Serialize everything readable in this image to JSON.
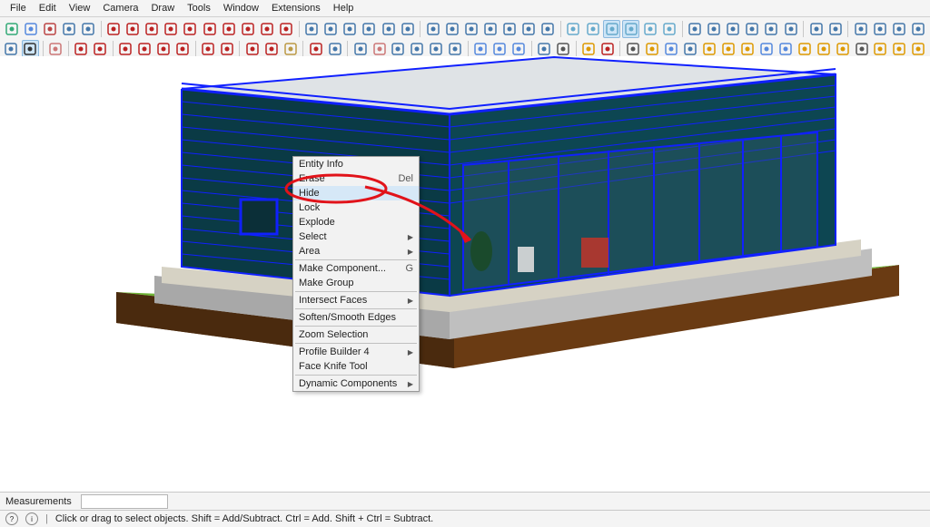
{
  "menu": [
    "File",
    "Edit",
    "View",
    "Camera",
    "Draw",
    "Tools",
    "Window",
    "Extensions",
    "Help"
  ],
  "toolbar_row1": [
    {
      "n": "today-icon",
      "c": "#3a7"
    },
    {
      "n": "component-icon",
      "c": "#58d"
    },
    {
      "n": "realtime-icon",
      "c": "#b44"
    },
    {
      "n": "undo-icon",
      "c": "#47a"
    },
    {
      "n": "redo-icon",
      "c": "#47a"
    },
    {
      "s": true
    },
    {
      "n": "line-icon",
      "c": "#b22"
    },
    {
      "n": "freehand-icon",
      "c": "#b22"
    },
    {
      "n": "rectangle-icon",
      "c": "#b22"
    },
    {
      "n": "rotrect-icon",
      "c": "#b22"
    },
    {
      "n": "circle-icon",
      "c": "#b22"
    },
    {
      "n": "polygon-icon",
      "c": "#b22"
    },
    {
      "n": "arc-icon",
      "c": "#b22"
    },
    {
      "n": "arc2-icon",
      "c": "#b22"
    },
    {
      "n": "arc3-icon",
      "c": "#b22"
    },
    {
      "n": "pie-icon",
      "c": "#b22"
    },
    {
      "s": true
    },
    {
      "n": "tape-icon",
      "c": "#47a"
    },
    {
      "n": "dimension-icon",
      "c": "#47a"
    },
    {
      "n": "protractor-icon",
      "c": "#47a"
    },
    {
      "n": "text-icon",
      "c": "#47a"
    },
    {
      "n": "axes-icon",
      "c": "#47a"
    },
    {
      "n": "3dtext-icon",
      "c": "#47a"
    },
    {
      "s": true
    },
    {
      "n": "iso-icon",
      "c": "#47a"
    },
    {
      "n": "top-icon",
      "c": "#47a"
    },
    {
      "n": "front-icon",
      "c": "#47a"
    },
    {
      "n": "right-icon",
      "c": "#47a"
    },
    {
      "n": "back-icon",
      "c": "#47a"
    },
    {
      "n": "left-icon",
      "c": "#47a"
    },
    {
      "n": "bottom-icon",
      "c": "#47a"
    },
    {
      "s": true
    },
    {
      "n": "xray-icon",
      "c": "#6ac"
    },
    {
      "n": "wireframe-icon",
      "c": "#6ac"
    },
    {
      "n": "hidden-icon",
      "c": "#6ac",
      "a": true
    },
    {
      "n": "shaded-icon",
      "c": "#6ac",
      "a": true
    },
    {
      "n": "shadedtex-icon",
      "c": "#6ac"
    },
    {
      "n": "mono-icon",
      "c": "#6ac"
    },
    {
      "s": true
    },
    {
      "n": "solid1-icon",
      "c": "#47a"
    },
    {
      "n": "solid2-icon",
      "c": "#47a"
    },
    {
      "n": "solid3-icon",
      "c": "#47a"
    },
    {
      "n": "solid4-icon",
      "c": "#47a"
    },
    {
      "n": "solid5-icon",
      "c": "#47a"
    },
    {
      "n": "solid6-icon",
      "c": "#47a"
    },
    {
      "s": true
    },
    {
      "n": "solid7-icon",
      "c": "#47a"
    },
    {
      "n": "solid8-icon",
      "c": "#47a"
    },
    {
      "s": true
    },
    {
      "n": "gear1-icon",
      "c": "#47a"
    },
    {
      "n": "gear2-icon",
      "c": "#47a"
    },
    {
      "n": "gear3-icon",
      "c": "#47a"
    },
    {
      "n": "gear4-icon",
      "c": "#47a"
    }
  ],
  "toolbar_row2": [
    {
      "n": "zoom-icon",
      "c": "#47a"
    },
    {
      "n": "select-icon",
      "c": "#333",
      "a": true
    },
    {
      "s": true
    },
    {
      "n": "eraser-icon",
      "c": "#c77"
    },
    {
      "s": true
    },
    {
      "n": "line2-icon",
      "c": "#b22"
    },
    {
      "n": "freehand2-icon",
      "c": "#b22"
    },
    {
      "s": true
    },
    {
      "n": "rect2-icon",
      "c": "#b22"
    },
    {
      "n": "rotrect2-icon",
      "c": "#b22"
    },
    {
      "n": "circle2-icon",
      "c": "#b22"
    },
    {
      "n": "arc2b-icon",
      "c": "#b22"
    },
    {
      "s": true
    },
    {
      "n": "pushpull-icon",
      "c": "#b22"
    },
    {
      "n": "offset-icon",
      "c": "#b22"
    },
    {
      "s": true
    },
    {
      "n": "move-icon",
      "c": "#b22"
    },
    {
      "n": "rotate-icon",
      "c": "#b22"
    },
    {
      "n": "scale-icon",
      "c": "#b94"
    },
    {
      "s": true
    },
    {
      "n": "followme-icon",
      "c": "#b22"
    },
    {
      "n": "section-icon",
      "c": "#47a"
    },
    {
      "s": true
    },
    {
      "n": "orbit-icon",
      "c": "#47a"
    },
    {
      "n": "pan-icon",
      "c": "#c77"
    },
    {
      "n": "zoom2-icon",
      "c": "#47a"
    },
    {
      "n": "zoomwin-icon",
      "c": "#47a"
    },
    {
      "n": "zoomext-icon",
      "c": "#47a"
    },
    {
      "n": "prev-icon",
      "c": "#47a"
    },
    {
      "s": true
    },
    {
      "n": "layers1-icon",
      "c": "#58d"
    },
    {
      "n": "layers2-icon",
      "c": "#58d"
    },
    {
      "n": "layers3-icon",
      "c": "#58d"
    },
    {
      "s": true
    },
    {
      "n": "newdoc-icon",
      "c": "#47a"
    },
    {
      "n": "person-icon",
      "c": "#555"
    },
    {
      "s": true
    },
    {
      "n": "ext1-icon",
      "c": "#d90"
    },
    {
      "n": "ext2-icon",
      "c": "#b22"
    },
    {
      "s": true
    },
    {
      "n": "ext3-icon",
      "c": "#555"
    },
    {
      "n": "ext4-icon",
      "c": "#d90"
    },
    {
      "n": "ext5-icon",
      "c": "#58d"
    },
    {
      "n": "ext6-icon",
      "c": "#47a"
    },
    {
      "n": "ext7-icon",
      "c": "#d90"
    },
    {
      "n": "ext8-icon",
      "c": "#d90"
    },
    {
      "n": "ext9-icon",
      "c": "#d90"
    },
    {
      "n": "ext10-icon",
      "c": "#58d"
    },
    {
      "n": "ext11-icon",
      "c": "#58d"
    },
    {
      "n": "ext12-icon",
      "c": "#d90"
    },
    {
      "n": "ext13-icon",
      "c": "#d90"
    },
    {
      "n": "ext14-icon",
      "c": "#d90"
    },
    {
      "n": "ext15-icon",
      "c": "#555"
    },
    {
      "n": "ext16-icon",
      "c": "#d90"
    },
    {
      "n": "ext17-icon",
      "c": "#d90"
    },
    {
      "n": "ext18-icon",
      "c": "#d90"
    }
  ],
  "context_menu": {
    "groups": [
      [
        {
          "l": "Entity Info"
        },
        {
          "l": "Erase",
          "sc": "Del"
        },
        {
          "l": "Hide",
          "hl": true
        },
        {
          "l": "Lock"
        },
        {
          "l": "Explode"
        },
        {
          "l": "Select",
          "sub": true
        },
        {
          "l": "Area",
          "sub": true
        }
      ],
      [
        {
          "l": "Make Component...",
          "sc": "G"
        },
        {
          "l": "Make Group"
        }
      ],
      [
        {
          "l": "Intersect Faces",
          "sub": true
        }
      ],
      [
        {
          "l": "Soften/Smooth Edges"
        }
      ],
      [
        {
          "l": "Zoom Selection"
        }
      ],
      [
        {
          "l": "Profile Builder 4",
          "sub": true
        },
        {
          "l": "Face Knife Tool"
        }
      ],
      [
        {
          "l": "Dynamic Components",
          "sub": true
        }
      ]
    ]
  },
  "measurements_label": "Measurements",
  "measurements_value": "",
  "status_hint": "Click or drag to select objects. Shift = Add/Subtract. Ctrl = Add. Shift + Ctrl = Subtract.",
  "status_icons": [
    "?",
    "i"
  ]
}
